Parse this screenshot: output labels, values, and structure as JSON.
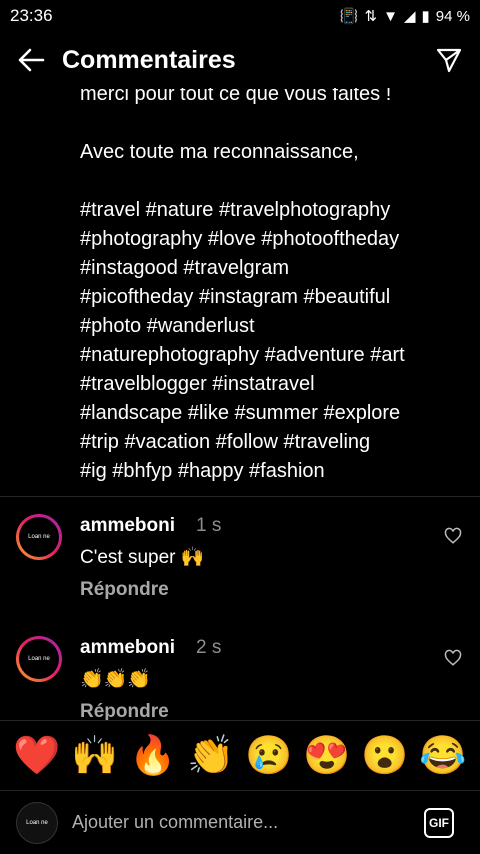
{
  "status": {
    "time": "23:36",
    "battery": "94 %"
  },
  "header": {
    "title": "Commentaires"
  },
  "caption": {
    "cut_line": "merci pour tout ce que vous faites !",
    "closing": "Avec toute ma reconnaissance,",
    "hashtags": [
      "#travel #nature #travelphotography",
      "#photography #love #photooftheday",
      "#instagood #travelgram",
      "#picoftheday #instagram #beautiful",
      "#photo #wanderlust",
      "#naturephotography #adventure #art",
      "#travelblogger #instatravel",
      "#landscape #like #summer #explore",
      "#trip #vacation #follow #traveling",
      "#ig #bhfyp #happy #fashion"
    ]
  },
  "comments": [
    {
      "user": "ammeboni",
      "time": "1 s",
      "text": "C'est super 🙌",
      "reply": "Répondre"
    },
    {
      "user": "ammeboni",
      "time": "2 s",
      "text": "👏👏👏",
      "reply": "Répondre"
    }
  ],
  "emoji_bar": [
    "❤️",
    "🙌",
    "🔥",
    "👏",
    "😢",
    "😍",
    "😮",
    "😂"
  ],
  "input": {
    "placeholder": "Ajouter un commentaire...",
    "gif_label": "GIF"
  },
  "avatar_text": "Loan ne"
}
